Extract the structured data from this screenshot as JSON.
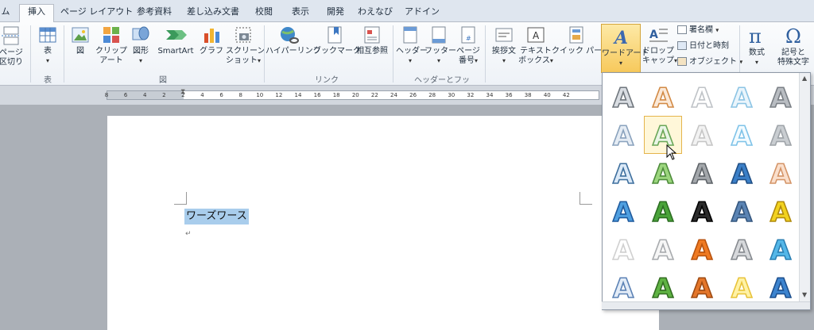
{
  "tabs": [
    "ム",
    "挿入",
    "ページ レイアウト",
    "参考資料",
    "差し込み文書",
    "校閲",
    "表示",
    "開発",
    "わえなび",
    "アドイン"
  ],
  "ribbon": {
    "page_break": [
      "ページ",
      "区切り"
    ],
    "table": "表",
    "picture": "図",
    "clipart": [
      "クリップ",
      "アート"
    ],
    "shapes": "図形",
    "smartart": "SmartArt",
    "chart": "グラフ",
    "screenshot": [
      "スクリーン",
      "ショット"
    ],
    "hyperlink": "ハイパーリンク",
    "bookmark": "ブックマーク",
    "crossref": "相互参照",
    "header": "ヘッダー",
    "footer": "フッター",
    "page_number": [
      "ページ",
      "番号"
    ],
    "greeting": "挨拶文",
    "textbox": [
      "テキスト",
      "ボックス"
    ],
    "quickparts": "クイック パーツ",
    "wordart": "ワードアート",
    "dropcap": [
      "ドロップ",
      "キャップ"
    ],
    "signature": "署名欄",
    "datetime": "日付と時刻",
    "object": "オブジェクト",
    "equation": "数式",
    "symbol": [
      "記号と",
      "特殊文字"
    ],
    "group_table": "表",
    "group_figure": "図",
    "group_link": "リンク",
    "group_headerfooter": "ヘッダーとフッター"
  },
  "ruler_ticks": [
    "8",
    "6",
    "4",
    "2",
    "2",
    "4",
    "6",
    "8",
    "10",
    "12",
    "14",
    "16",
    "18",
    "20",
    "22",
    "24",
    "26",
    "28",
    "30",
    "32",
    "34",
    "36",
    "38",
    "40",
    "42"
  ],
  "document": {
    "selected_text": "ワーズワース",
    "para_mark": "↵"
  },
  "gallery": {
    "rows": [
      [
        "plain-gray",
        "orange-outline",
        "light-gray-outline",
        "light-blue-outline",
        "gray-shadow"
      ],
      [
        "blue-gray-outline",
        "green-outline",
        "silver-gradient",
        "light-blue-glow",
        "gray-soft"
      ],
      [
        "blue-outline",
        "green-gradient",
        "gray-metal",
        "blue-solid",
        "peach-outline"
      ],
      [
        "blue-bold",
        "green-bold",
        "black-glow",
        "blue-shadow",
        "gold-bold"
      ],
      [
        "white-outline",
        "silver-outline",
        "orange-bold",
        "gray-outline",
        "cyan-reflect"
      ],
      [
        "blue-outline-2",
        "green-bold-2",
        "orange-bevel",
        "yellow-glow",
        "blue-reflect"
      ]
    ],
    "colors": {
      "plain-gray": [
        "#d9dde2",
        "#6f767d"
      ],
      "orange-outline": [
        "#fbe9d8",
        "#d28a45"
      ],
      "light-gray-outline": [
        "#ffffff",
        "#bfc3c7"
      ],
      "light-blue-outline": [
        "#eaf5fc",
        "#8cc4e4"
      ],
      "gray-shadow": [
        "#b9bdc2",
        "#7a7f85"
      ],
      "blue-gray-outline": [
        "#e5ecf4",
        "#8aa2bd"
      ],
      "green-outline": [
        "#eaf5e6",
        "#6aa758"
      ],
      "silver-gradient": [
        "#f2f2f2",
        "#c6c6c6"
      ],
      "light-blue-glow": [
        "#f3fbff",
        "#7fc3e8"
      ],
      "gray-soft": [
        "#c9cdd1",
        "#9ea3a8"
      ],
      "blue-outline": [
        "#dbe9f7",
        "#3e6f9e"
      ],
      "green-gradient": [
        "#9bd57d",
        "#4e8c3b"
      ],
      "gray-metal": [
        "#a3a7ab",
        "#5e6368"
      ],
      "blue-solid": [
        "#3b7fc7",
        "#204f85"
      ],
      "peach-outline": [
        "#fadfcc",
        "#d49467"
      ],
      "blue-bold": [
        "#4f9fe0",
        "#1e5a9d"
      ],
      "green-bold": [
        "#4aa33a",
        "#2c6e22"
      ],
      "black-glow": [
        "#2b2b2b",
        "#000000"
      ],
      "blue-shadow": [
        "#5b84b4",
        "#34567e"
      ],
      "gold-bold": [
        "#f2d21f",
        "#b08a0c"
      ],
      "white-outline": [
        "#ffffff",
        "#d0d0d0"
      ],
      "silver-outline": [
        "#f6f6f6",
        "#a8abae"
      ],
      "orange-bold": [
        "#ef7a22",
        "#b8520d"
      ],
      "gray-outline": [
        "#d6d8db",
        "#868a8f"
      ],
      "cyan-reflect": [
        "#54b7e8",
        "#2a7fb3"
      ],
      "blue-outline-2": [
        "#e3ecf7",
        "#5c82b5"
      ],
      "green-bold-2": [
        "#5fb343",
        "#336e22"
      ],
      "orange-bevel": [
        "#e4762a",
        "#9e4a12"
      ],
      "yellow-glow": [
        "#fff2a6",
        "#e8c33a"
      ],
      "blue-reflect": [
        "#3d84cf",
        "#1d4f8d"
      ]
    },
    "selected": "green-outline"
  }
}
